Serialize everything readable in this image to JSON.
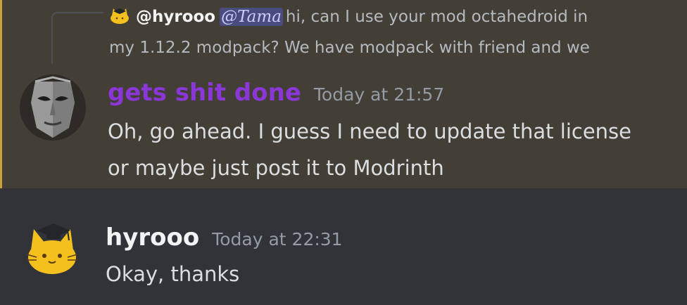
{
  "reply_preview": {
    "author": "@hyrooo",
    "mention": "@Tama",
    "line1": "hi, can I use your mod octahedroid in",
    "line2": "my 1.12.2 modpack? We have modpack with friend and we",
    "avatar_icon": "cat-graduation-cap-icon"
  },
  "messages": [
    {
      "author": "gets shit done",
      "author_color": "#8b36d6",
      "timestamp": "Today at 21:57",
      "lines": [
        "Oh, go ahead. I guess I need to update that license",
        "or maybe just post it to Modrinth"
      ],
      "avatar_icon": "stone-mask-avatar",
      "highlighted": true
    },
    {
      "author": "hyrooo",
      "author_color": "#f2f3f5",
      "timestamp": "Today at 22:31",
      "lines": [
        "Okay, thanks"
      ],
      "avatar_icon": "cat-graduation-cap-icon"
    }
  ],
  "colors": {
    "background": "#313338",
    "highlight_background": "#433f37",
    "highlight_border": "#c9a23a",
    "mention_background": "#4a4b7e"
  }
}
